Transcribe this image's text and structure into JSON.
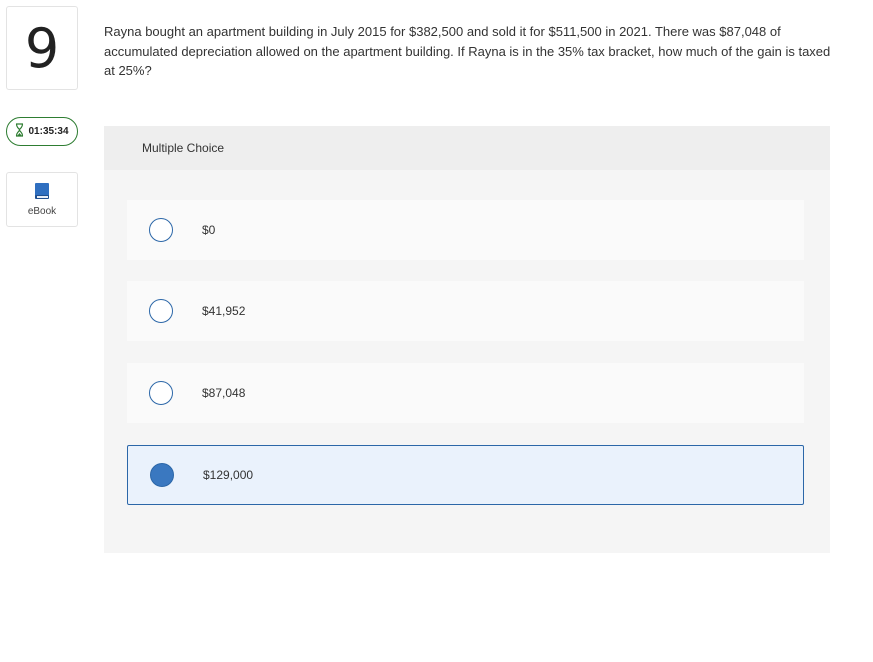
{
  "question_number": "9",
  "timer": {
    "time": "01:35:34",
    "icon": "hourglass-icon"
  },
  "ebook": {
    "label": "eBook",
    "icon": "book-icon"
  },
  "question": {
    "text": "Rayna bought an apartment building in July 2015 for $382,500 and sold it for $511,500 in 2021. There was $87,048 of accumulated depreciation allowed on the apartment building. If Rayna is in the 35% tax bracket, how much of the gain is taxed at 25%?"
  },
  "multiple_choice": {
    "header": "Multiple Choice",
    "options": [
      {
        "label": "$0",
        "selected": false
      },
      {
        "label": "$41,952",
        "selected": false
      },
      {
        "label": "$87,048",
        "selected": false
      },
      {
        "label": "$129,000",
        "selected": true
      }
    ]
  },
  "colors": {
    "accent": "#2c67a8",
    "timer_border": "#2e7d32",
    "selected_bg": "#eaf2fc"
  }
}
